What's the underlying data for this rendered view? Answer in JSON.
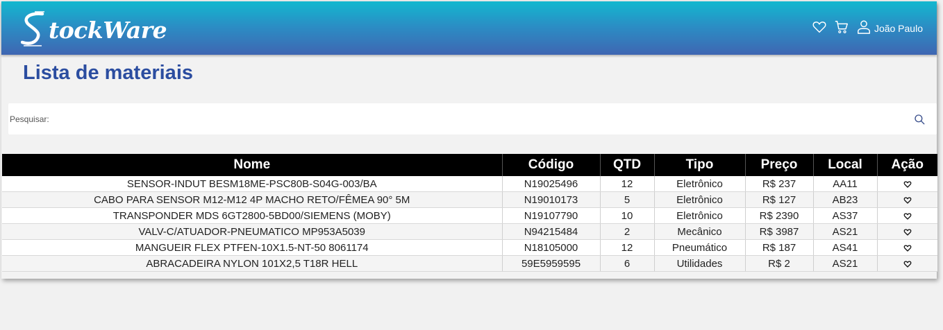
{
  "app": {
    "logo_text": "tockWare"
  },
  "header": {
    "icons": [
      "heart-icon",
      "cart-icon",
      "user-icon"
    ],
    "user_name": "João Paulo"
  },
  "page": {
    "title": "Lista de materiais"
  },
  "search": {
    "label": "Pesquisar:",
    "value": "",
    "icon": "search-icon"
  },
  "table": {
    "columns": [
      "Nome",
      "Código",
      "QTD",
      "Tipo",
      "Preço",
      "Local",
      "Ação"
    ],
    "rows": [
      {
        "nome": "SENSOR-INDUT BESM18ME-PSC80B-S04G-003/BA",
        "codigo": "N19025496",
        "qtd": "12",
        "tipo": "Eletrônico",
        "preco": "R$ 237",
        "local": "AA11",
        "acao_icon": "heart-icon"
      },
      {
        "nome": "CABO PARA SENSOR M12-M12 4P MACHO RETO/FÊMEA 90° 5M",
        "codigo": "N19010173",
        "qtd": "5",
        "tipo": "Eletrônico",
        "preco": "R$ 127",
        "local": "AB23",
        "acao_icon": "heart-icon"
      },
      {
        "nome": "TRANSPONDER MDS 6GT2800-5BD00/SIEMENS (MOBY)",
        "codigo": "N19107790",
        "qtd": "10",
        "tipo": "Eletrônico",
        "preco": "R$ 2390",
        "local": "AS37",
        "acao_icon": "heart-icon"
      },
      {
        "nome": "VALV-C/ATUADOR-PNEUMATICO MP953A5039",
        "codigo": "N94215484",
        "qtd": "2",
        "tipo": "Mecânico",
        "preco": "R$ 3987",
        "local": "AS21",
        "acao_icon": "heart-icon"
      },
      {
        "nome": "MANGUEIR FLEX PTFEN-10X1.5-NT-50 8061174",
        "codigo": "N18105000",
        "qtd": "12",
        "tipo": "Pneumático",
        "preco": "R$ 187",
        "local": "AS41",
        "acao_icon": "heart-icon"
      },
      {
        "nome": "ABRACADEIRA NYLON 101X2,5 T18R HELL",
        "codigo": "59E5959595",
        "qtd": "6",
        "tipo": "Utilidades",
        "preco": "R$ 2",
        "local": "AS21",
        "acao_icon": "heart-icon"
      }
    ]
  },
  "colors": {
    "header_gradient_top": "#12b8cf",
    "header_gradient_bottom": "#3f66b2",
    "title": "#2b4da0",
    "table_header_bg": "#000000"
  }
}
